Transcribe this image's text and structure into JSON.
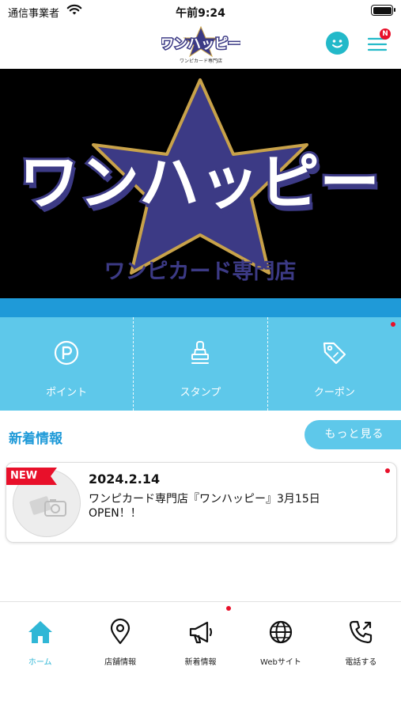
{
  "status_bar": {
    "carrier": "通信事業者",
    "time": "午前9:24"
  },
  "header": {
    "logo_text": "ワンハッピー",
    "logo_subtitle": "ワンピカード専門店",
    "menu_badge": "N"
  },
  "hero": {
    "title": "ワンハッピー",
    "subtitle": "ワンピカード専門店"
  },
  "quick_menu": [
    {
      "label": "ポイント",
      "icon": "point-icon"
    },
    {
      "label": "スタンプ",
      "icon": "stamp-icon"
    },
    {
      "label": "クーポン",
      "icon": "coupon-tag-icon"
    }
  ],
  "news": {
    "section_title": "新着情報",
    "more_label": "もっと見る",
    "items": [
      {
        "badge": "NEW",
        "date": "2024.2.14",
        "text": "ワンピカード専門店『ワンハッピー』3月15日OPEN！！"
      }
    ]
  },
  "tabs": [
    {
      "label": "ホーム",
      "icon": "home-icon"
    },
    {
      "label": "店舗情報",
      "icon": "location-pin-icon"
    },
    {
      "label": "新着情報",
      "icon": "megaphone-icon"
    },
    {
      "label": "Webサイト",
      "icon": "globe-icon"
    },
    {
      "label": "電話する",
      "icon": "phone-call-icon"
    }
  ],
  "colors": {
    "accent": "#5ec8ea",
    "accent_dark": "#1f9ad8",
    "star": "#3c3a85",
    "star_outline": "#c8a24a",
    "badge_red": "#e8102a"
  }
}
